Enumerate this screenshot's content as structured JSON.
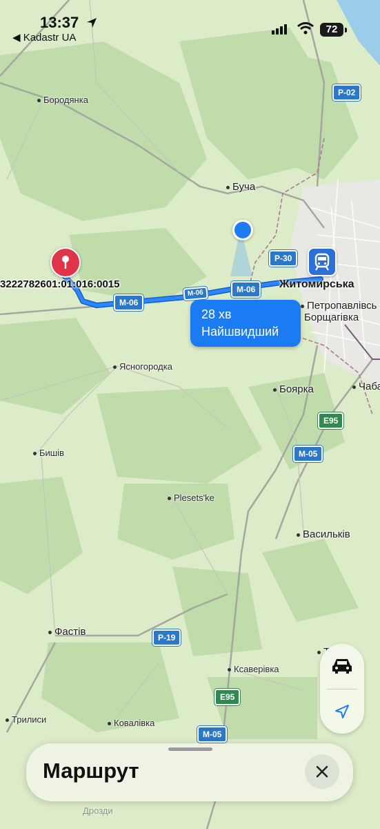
{
  "status": {
    "time": "13:37",
    "back_app": "◀ Kadastr UA",
    "battery": "72"
  },
  "map": {
    "places": {
      "borodyanka": "Бородянка",
      "bucha": "Буча",
      "yasnogorodka": "Ясногородка",
      "bishiv": "Бишів",
      "plesets": "Plesets'ke",
      "boiarka": "Боярка",
      "chaba": "Чаба",
      "vasylkiv": "Васильків",
      "fastiv": "Фастів",
      "ksaverivka": "Ксаверівка",
      "trylisy": "Трилиси",
      "kovalivka": "Ковалівка",
      "petro1": "Петропавлівсь",
      "petro2": "Борщагівка",
      "partial_t": "Т",
      "partial_drozd": "Дрозди"
    },
    "roads": {
      "p02": "Р-02",
      "p30": "Р-30",
      "m06a": "М-06",
      "m06b": "М-06",
      "m06c": "М-06",
      "e95a": "E95",
      "m05a": "М-05",
      "p19": "Р-19",
      "e95b": "E95",
      "m05b": "М-05"
    },
    "pin_label": "3222782601:01:016:0015",
    "metro_label": "Житомирська",
    "route": {
      "duration": "28 хв",
      "type": "Найшвидший"
    }
  },
  "bottom_sheet": {
    "title": "Маршрут"
  }
}
